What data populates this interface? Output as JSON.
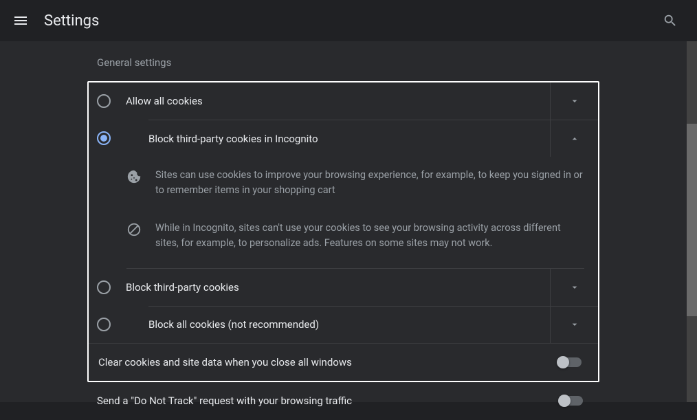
{
  "header": {
    "title": "Settings"
  },
  "section_title": "General settings",
  "options": {
    "allow_all": {
      "label": "Allow all cookies",
      "selected": false,
      "expanded": false
    },
    "block_incognito": {
      "label": "Block third-party cookies in Incognito",
      "selected": true,
      "expanded": true,
      "desc1": "Sites can use cookies to improve your browsing experience, for example, to keep you signed in or to remember items in your shopping cart",
      "desc2": "While in Incognito, sites can't use your cookies to see your browsing activity across different sites, for example, to personalize ads. Features on some sites may not work."
    },
    "block_third": {
      "label": "Block third-party cookies",
      "selected": false,
      "expanded": false
    },
    "block_all": {
      "label": "Block all cookies (not recommended)",
      "selected": false,
      "expanded": false
    }
  },
  "toggles": {
    "clear_on_close": {
      "label": "Clear cookies and site data when you close all windows",
      "value": false
    },
    "do_not_track": {
      "label": "Send a \"Do Not Track\" request with your browsing traffic",
      "value": false
    }
  }
}
